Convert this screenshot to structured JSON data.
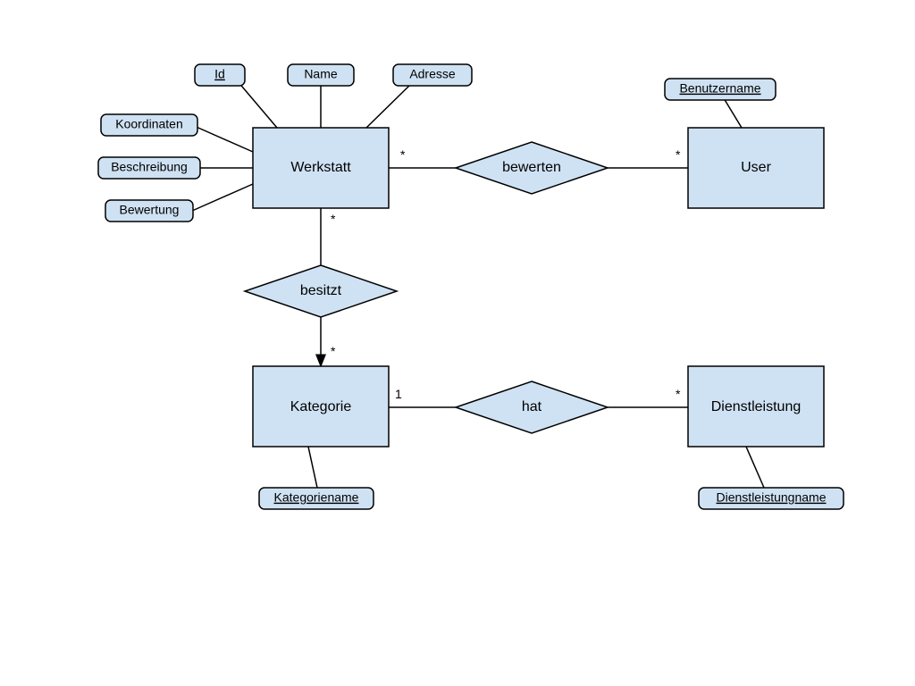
{
  "colors": {
    "fill": "#cfe2f3",
    "stroke": "#000000"
  },
  "entities": {
    "werkstatt": {
      "label": "Werkstatt"
    },
    "user": {
      "label": "User"
    },
    "kategorie": {
      "label": "Kategorie"
    },
    "dienstleistung": {
      "label": "Dienstleistung"
    }
  },
  "relationships": {
    "bewerten": {
      "label": "bewerten",
      "left": "Werkstatt",
      "right": "User",
      "card_left": "*",
      "card_right": "*"
    },
    "besitzt": {
      "label": "besitzt",
      "top": "Werkstatt",
      "bottom": "Kategorie",
      "card_top": "*",
      "card_bottom": "*",
      "arrow_to_bottom": true
    },
    "hat": {
      "label": "hat",
      "left": "Kategorie",
      "right": "Dienstleistung",
      "card_left": "1",
      "card_right": "*"
    }
  },
  "attributes": {
    "werkstatt": {
      "id": {
        "label": "Id",
        "key": true
      },
      "name": {
        "label": "Name",
        "key": false
      },
      "adresse": {
        "label": "Adresse",
        "key": false
      },
      "koordinaten": {
        "label": "Koordinaten",
        "key": false
      },
      "beschreibung": {
        "label": "Beschreibung",
        "key": false
      },
      "bewertung": {
        "label": "Bewertung",
        "key": false
      }
    },
    "user": {
      "benutzername": {
        "label": "Benutzername",
        "key": true
      }
    },
    "kategorie": {
      "kategoriename": {
        "label": "Kategoriename",
        "key": true
      }
    },
    "dienstleistung": {
      "dienstleistungname": {
        "label": "Dienstleistungname",
        "key": true
      }
    }
  }
}
